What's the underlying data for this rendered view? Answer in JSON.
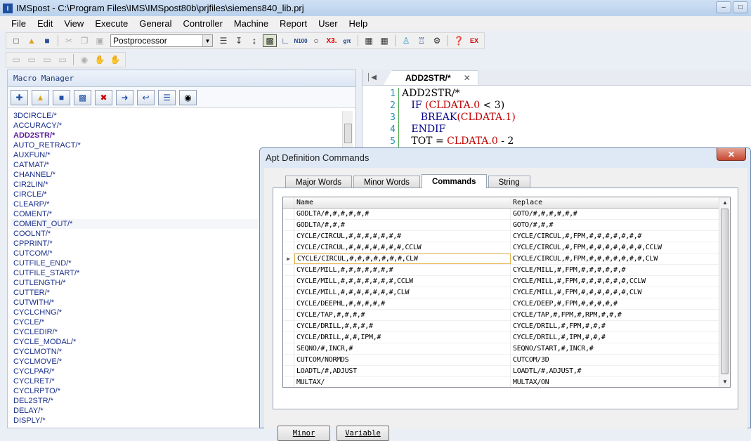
{
  "window": {
    "title": "IMSpost - C:\\Program Files\\IMS\\IMSpost80b\\prjfiles\\siemens840_lib.prj"
  },
  "menu": [
    "File",
    "Edit",
    "View",
    "Execute",
    "General",
    "Controller",
    "Machine",
    "Report",
    "User",
    "Help"
  ],
  "toolbar": {
    "combo_value": "Postprocessor"
  },
  "macro_manager": {
    "title": "Macro Manager",
    "items": [
      "3DCIRCLE/*",
      "ACCURACY/*",
      "ADD2STR/*",
      "AUTO_RETRACT/*",
      "AUXFUN/*",
      "CATMAT/*",
      "CHANNEL/*",
      "CIR2LIN/*",
      "CIRCLE/*",
      "CLEARP/*",
      "COMENT/*",
      "COMENT_OUT/*",
      "COOLNT/*",
      "CPPRINT/*",
      "CUTCOM/*",
      "CUTFILE_END/*",
      "CUTFILE_START/*",
      "CUTLENGTH/*",
      "CUTTER/*",
      "CUTWITH/*",
      "CYCLCHNG/*",
      "CYCLE/*",
      "CYCLEDIR/*",
      "CYCLE_MODAL/*",
      "CYCLMOTN/*",
      "CYCLMOVE/*",
      "CYCLPAR/*",
      "CYCLRET/*",
      "CYCLRPTO/*",
      "DEL2STR/*",
      "DELAY/*",
      "DISPLY/*"
    ]
  },
  "editor": {
    "tab_label": "ADD2STR/*",
    "line_numbers": [
      "1",
      "2",
      "3",
      "4",
      "5"
    ],
    "lines": [
      {
        "plain": "ADD2STR/*"
      },
      {
        "kw": "IF ",
        "red": "(CLDATA.0",
        "plain": " < 3)"
      },
      {
        "kw": "BREAK",
        "red": "(CLDATA.1)",
        "plain": ""
      },
      {
        "kw": "ENDIF",
        "red": "",
        "plain": ""
      },
      {
        "plain": "TOT = ",
        "red": "CLDATA.0",
        "plain2": " - 2"
      }
    ]
  },
  "dialog": {
    "title": "Apt Definition Commands",
    "tabs": [
      "Major Words",
      "Minor Words",
      "Commands",
      "String"
    ],
    "columns": {
      "name": "Name",
      "replace": "Replace"
    },
    "rows": [
      {
        "name": "GODLTA/#,#,#,#,#,#",
        "replace": "GOTO/#,#,#,#,#,#"
      },
      {
        "name": "GODLTA/#,#,#",
        "replace": "GOTO/#,#,#"
      },
      {
        "name": "CYCLE/CIRCUL,#,#,#,#,#,#,#",
        "replace": "CYCLE/CIRCUL,#,FPM,#,#,#,#,#,#,#"
      },
      {
        "name": "CYCLE/CIRCUL,#,#,#,#,#,#,#,CCLW",
        "replace": "CYCLE/CIRCUL,#,FPM,#,#,#,#,#,#,#,CCLW"
      },
      {
        "name": "CYCLE/CIRCUL,#,#,#,#,#,#,#,CLW",
        "replace": "CYCLE/CIRCUL,#,FPM,#,#,#,#,#,#,#,CLW"
      },
      {
        "name": "CYCLE/MILL,#,#,#,#,#,#,#",
        "replace": "CYCLE/MILL,#,FPM,#,#,#,#,#,#"
      },
      {
        "name": "CYCLE/MILL,#,#,#,#,#,#,#,CCLW",
        "replace": "CYCLE/MILL,#,FPM,#,#,#,#,#,#,CCLW"
      },
      {
        "name": "CYCLE/MILL,#,#,#,#,#,#,#,CLW",
        "replace": "CYCLE/MILL,#,FPM,#,#,#,#,#,#,CLW"
      },
      {
        "name": "CYCLE/DEEPHL,#,#,#,#,#",
        "replace": "CYCLE/DEEP,#,FPM,#,#,#,#,#"
      },
      {
        "name": "CYCLE/TAP,#,#,#,#",
        "replace": "CYCLE/TAP,#,FPM,#,RPM,#,#,#"
      },
      {
        "name": "CYCLE/DRILL,#,#,#,#",
        "replace": "CYCLE/DRILL,#,FPM,#,#,#"
      },
      {
        "name": "CYCLE/DRILL,#,#,IPM,#",
        "replace": "CYCLE/DRILL,#,IPM,#,#,#"
      },
      {
        "name": "SEQNO/#,INCR,#",
        "replace": "SEQNO/START,#,INCR,#"
      },
      {
        "name": "CUTCOM/NORMDS",
        "replace": "CUTCOM/3D"
      },
      {
        "name": "LOADTL/#,ADJUST",
        "replace": "LOADTL/#,ADJUST,#"
      },
      {
        "name": "MULTAX/",
        "replace": "MULTAX/ON"
      }
    ],
    "buttons": {
      "minor": "Minor",
      "variable": "Variable"
    }
  }
}
